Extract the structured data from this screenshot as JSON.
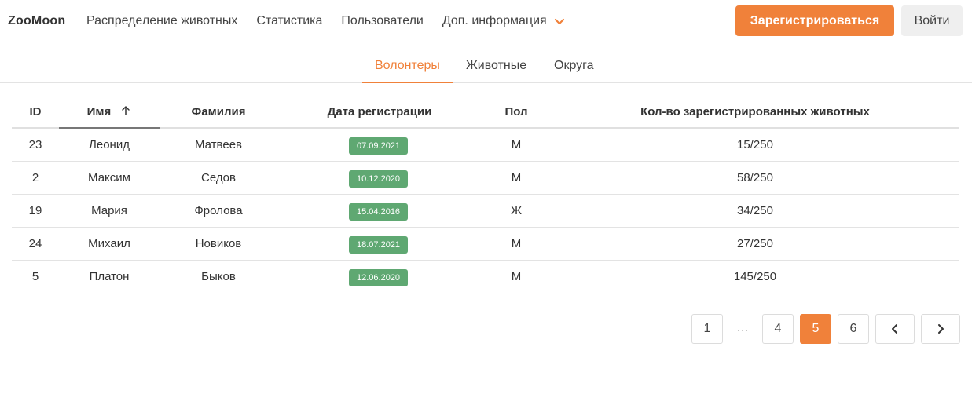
{
  "header": {
    "logo": "ZooMoon",
    "nav": [
      {
        "label": "Распределение животных"
      },
      {
        "label": "Статистика"
      },
      {
        "label": "Пользователи"
      },
      {
        "label": "Доп. информация"
      }
    ],
    "register_label": "Зарегистрироваться",
    "login_label": "Войти"
  },
  "tabs": [
    {
      "label": "Волонтеры",
      "active": true
    },
    {
      "label": "Животные",
      "active": false
    },
    {
      "label": "Округа",
      "active": false
    }
  ],
  "table": {
    "columns": {
      "id": "ID",
      "name": "Имя",
      "last": "Фамилия",
      "date": "Дата регистрации",
      "sex": "Пол",
      "count": "Кол-во зарегистрированных животных"
    },
    "sort": {
      "column": "name",
      "direction": "asc",
      "icon": "arrow-up-icon"
    },
    "rows": [
      {
        "id": "23",
        "name": "Леонид",
        "last": "Матвеев",
        "date": "07.09.2021",
        "sex": "М",
        "count": "15/250"
      },
      {
        "id": "2",
        "name": "Максим",
        "last": "Седов",
        "date": "10.12.2020",
        "sex": "М",
        "count": "58/250"
      },
      {
        "id": "19",
        "name": "Мария",
        "last": "Фролова",
        "date": "15.04.2016",
        "sex": "Ж",
        "count": "34/250"
      },
      {
        "id": "24",
        "name": "Михаил",
        "last": "Новиков",
        "date": "18.07.2021",
        "sex": "М",
        "count": "27/250"
      },
      {
        "id": "5",
        "name": "Платон",
        "last": "Быков",
        "date": "12.06.2020",
        "sex": "М",
        "count": "145/250"
      }
    ]
  },
  "pagination": {
    "first": "1",
    "ellipsis": "…",
    "pages": [
      "4",
      "5",
      "6"
    ],
    "current": "5",
    "prev_icon": "chevron-left-icon",
    "next_icon": "chevron-right-icon"
  },
  "colors": {
    "accent": "#f0813a",
    "badge": "#5fa872"
  }
}
